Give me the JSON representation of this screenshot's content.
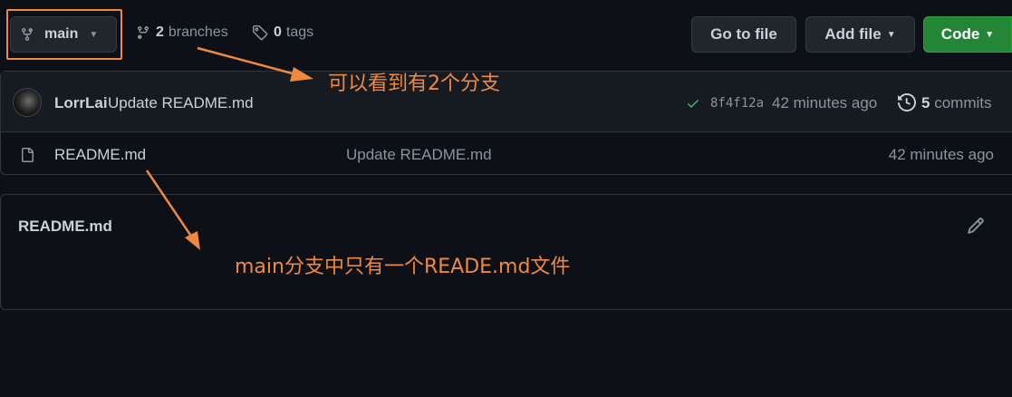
{
  "branch": {
    "current": "main",
    "branches_count": "2",
    "branches_label": "branches",
    "tags_count": "0",
    "tags_label": "tags"
  },
  "toolbar": {
    "go_to_file": "Go to file",
    "add_file": "Add file",
    "code": "Code"
  },
  "latest_commit": {
    "author": "LorrLai",
    "message": "Update README.md",
    "sha": "8f4f12a",
    "time": "42 minutes ago",
    "commits_count": "5",
    "commits_label": "commits"
  },
  "files": [
    {
      "name": "README.md",
      "commit_message": "Update README.md",
      "time": "42 minutes ago"
    }
  ],
  "readme": {
    "title": "README.md"
  },
  "annotations": {
    "branches_note": "可以看到有2个分支",
    "files_note": "main分支中只有一个READE.md文件"
  },
  "colors": {
    "accent": "#f0883e",
    "code_button": "#238636",
    "background": "#0d1117",
    "check": "#3fb950"
  },
  "icons": [
    "branch-icon",
    "tag-icon",
    "caret-down-icon",
    "check-icon",
    "history-icon",
    "file-icon",
    "pencil-icon"
  ]
}
